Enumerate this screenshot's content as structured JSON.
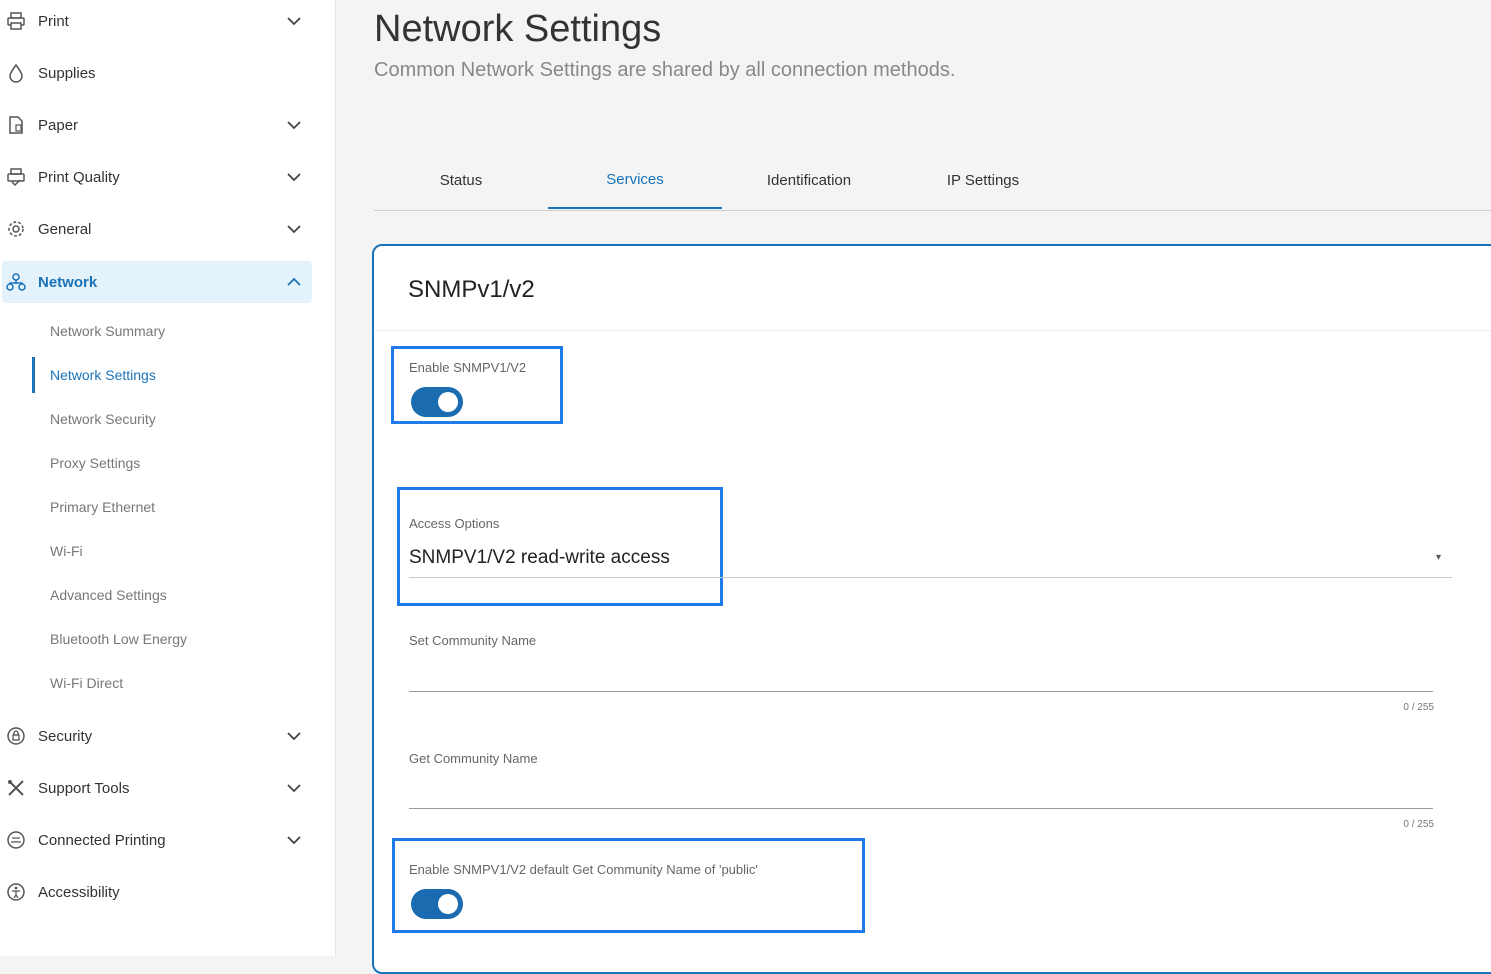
{
  "sidebar": {
    "items": [
      {
        "label": "Print",
        "icon": "printer-icon",
        "expandable": true
      },
      {
        "label": "Supplies",
        "icon": "ink-drop-icon",
        "expandable": false
      },
      {
        "label": "Paper",
        "icon": "paper-icon",
        "expandable": true
      },
      {
        "label": "Print Quality",
        "icon": "print-quality-icon",
        "expandable": true
      },
      {
        "label": "General",
        "icon": "gear-icon",
        "expandable": true
      },
      {
        "label": "Network",
        "icon": "network-icon",
        "expandable": true,
        "expanded": true
      }
    ],
    "network_sub": [
      {
        "label": "Network Summary"
      },
      {
        "label": "Network Settings",
        "active": true
      },
      {
        "label": "Network Security"
      },
      {
        "label": "Proxy Settings"
      },
      {
        "label": "Primary Ethernet"
      },
      {
        "label": "Wi-Fi"
      },
      {
        "label": "Advanced Settings"
      },
      {
        "label": "Bluetooth Low Energy"
      },
      {
        "label": "Wi-Fi Direct"
      }
    ],
    "items_after": [
      {
        "label": "Security",
        "icon": "shield-icon",
        "expandable": true
      },
      {
        "label": "Support Tools",
        "icon": "tools-icon",
        "expandable": true
      },
      {
        "label": "Connected Printing",
        "icon": "cloud-printing-icon",
        "expandable": true
      },
      {
        "label": "Accessibility",
        "icon": "accessibility-icon",
        "expandable": false
      }
    ]
  },
  "main": {
    "title": "Network Settings",
    "subtitle": "Common Network Settings are shared by all connection methods.",
    "tabs": [
      {
        "label": "Status"
      },
      {
        "label": "Services",
        "active": true
      },
      {
        "label": "Identification"
      },
      {
        "label": "IP Settings"
      }
    ],
    "card": {
      "title": "SNMPv1/v2",
      "enable_toggle": {
        "label": "Enable SNMPV1/V2",
        "on": true
      },
      "access_options": {
        "label": "Access Options",
        "value": "SNMPV1/V2 read-write access"
      },
      "set_community": {
        "label": "Set Community Name",
        "value": "",
        "counter": "0 / 255"
      },
      "get_community": {
        "label": "Get Community Name",
        "value": "",
        "counter": "0 / 255"
      },
      "default_public_toggle": {
        "label": "Enable SNMPV1/V2 default Get Community Name of 'public'",
        "on": true
      }
    }
  },
  "colors": {
    "accent": "#1a73b8",
    "highlight_box": "#1e7be8",
    "toggle_on": "#1a6bb0",
    "active_nav_bg": "#e3f2fb"
  }
}
